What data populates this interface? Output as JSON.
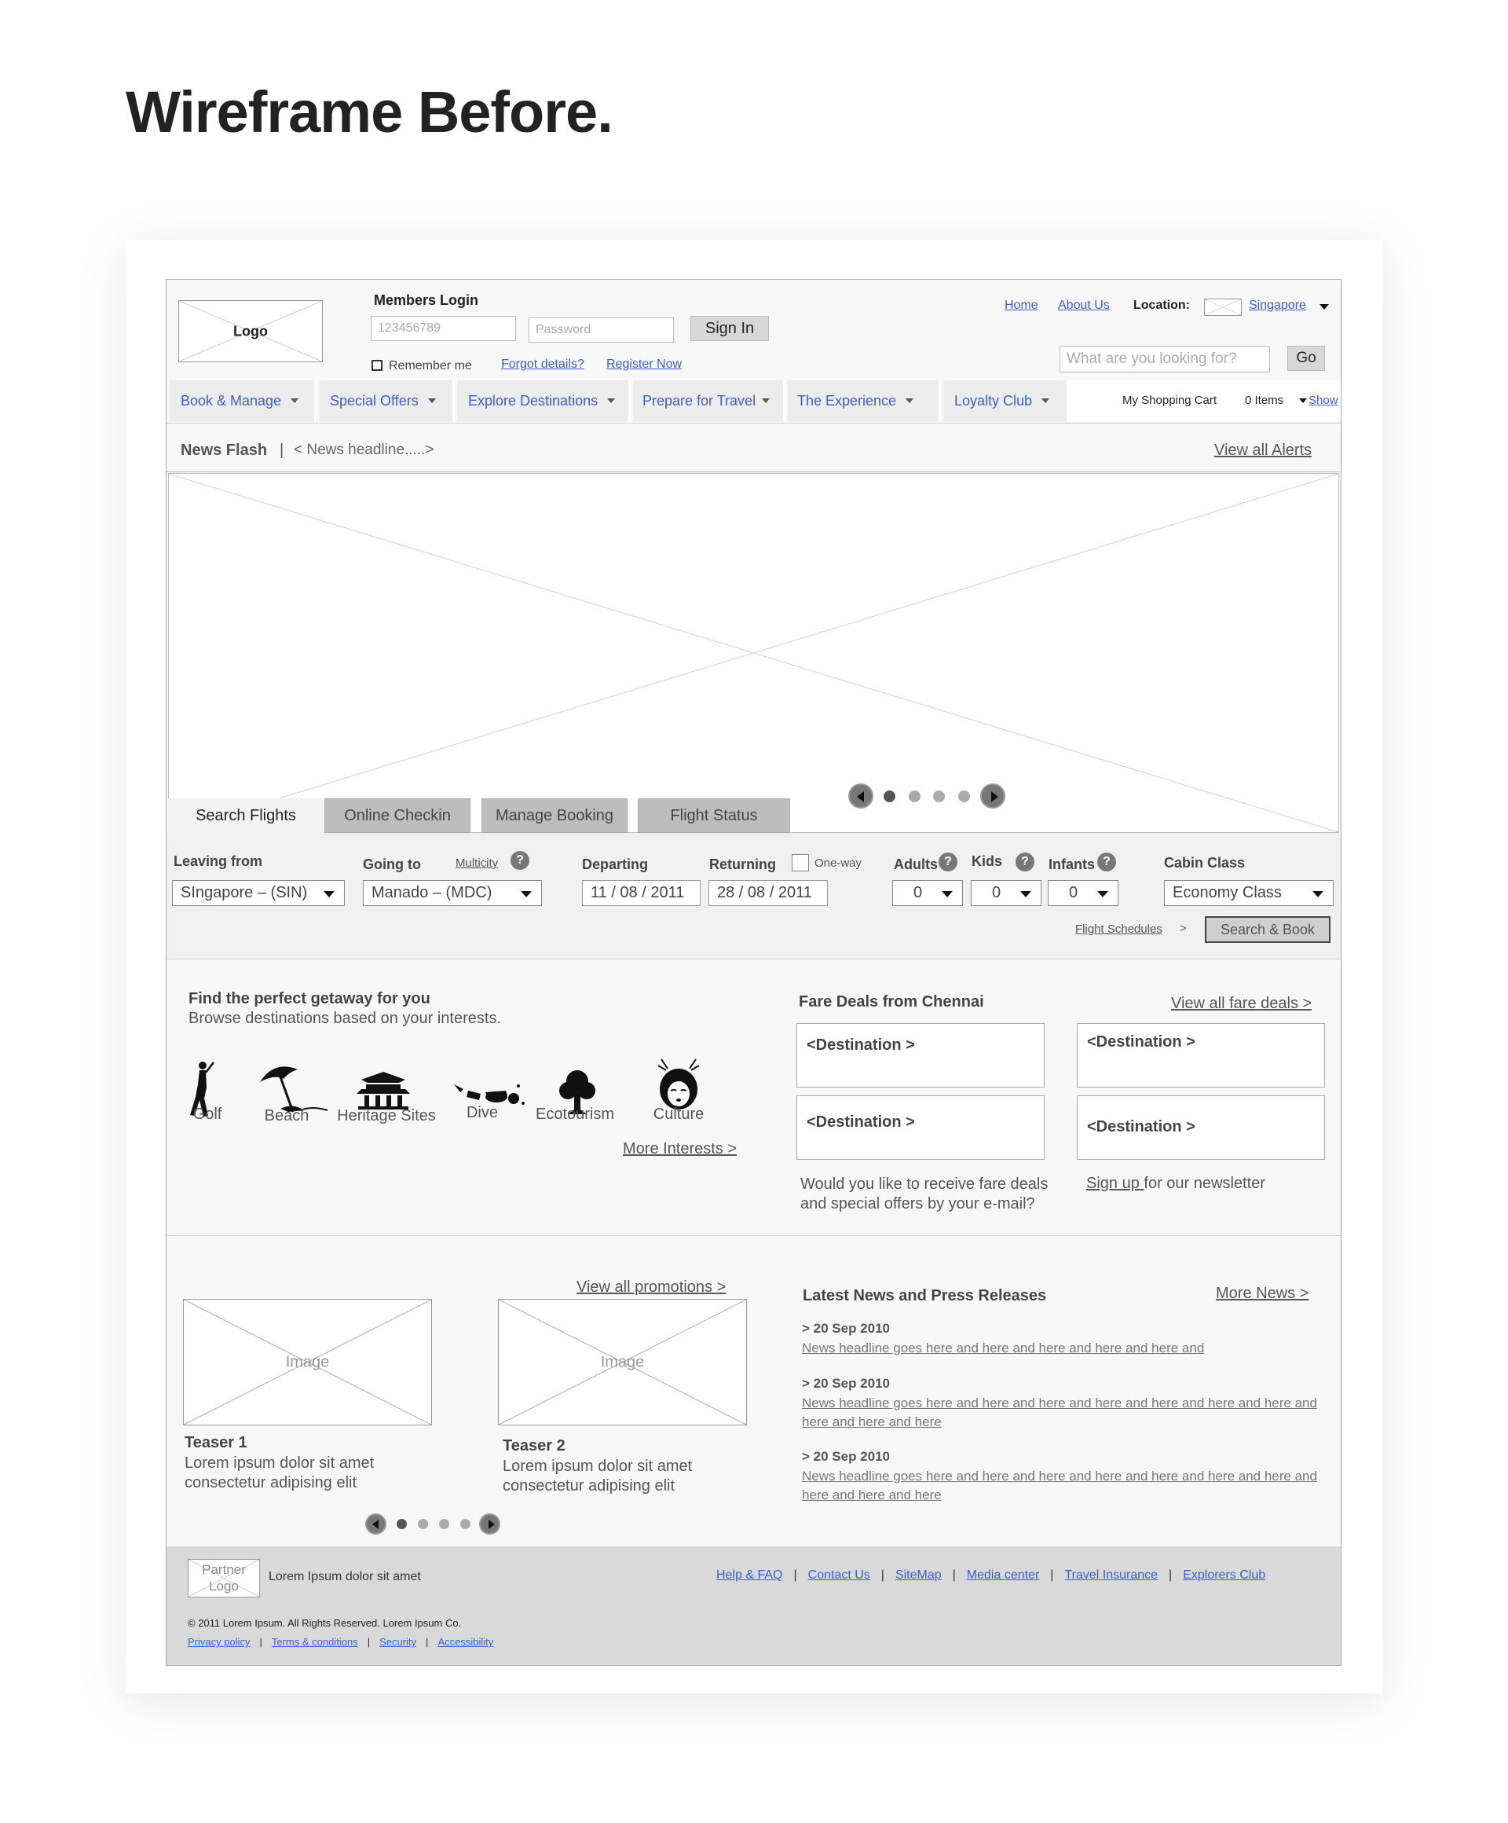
{
  "page_heading": "Wireframe Before.",
  "header": {
    "logo": "Logo",
    "members_login": "Members Login",
    "member_id_placeholder": "123456789",
    "password_placeholder": "Password",
    "sign_in": "Sign In",
    "remember_me": "Remember me",
    "forgot_details": "Forgot details?",
    "register_now": "Register Now",
    "home": "Home",
    "about_us": "About Us",
    "location_label": "Location:",
    "location_value": "Singapore",
    "search_placeholder": "What are you looking for?",
    "go": "Go",
    "cart_label": "My Shopping Cart",
    "cart_items": "0 Items",
    "cart_show": "Show"
  },
  "nav": {
    "items": [
      {
        "label": "Book & Manage"
      },
      {
        "label": "Special Offers"
      },
      {
        "label": "Explore Destinations"
      },
      {
        "label": "Prepare for Travel"
      },
      {
        "label": "The Experience"
      },
      {
        "label": "Loyalty Club"
      }
    ]
  },
  "news_flash": {
    "label": "News Flash",
    "separator": "|",
    "headline": "< News headline.....>",
    "view_all": "View all Alerts"
  },
  "booking": {
    "tabs": [
      {
        "label": "Search Flights",
        "active": true
      },
      {
        "label": "Online Checkin",
        "active": false
      },
      {
        "label": "Manage Booking",
        "active": false
      },
      {
        "label": "Flight Status",
        "active": false
      }
    ],
    "leaving_from": {
      "label": "Leaving from",
      "value": "SIngapore – (SIN)"
    },
    "going_to": {
      "label": "Going to",
      "value": "Manado – (MDC)"
    },
    "multicity": "Multicity",
    "departing": {
      "label": "Departing",
      "value": "11 / 08 / 2011"
    },
    "returning": {
      "label": "Returning",
      "value": "28 / 08 / 2011"
    },
    "one_way": "One-way",
    "adults": {
      "label": "Adults",
      "value": "0"
    },
    "kids": {
      "label": "Kids",
      "value": "0"
    },
    "infants": {
      "label": "Infants",
      "value": "0"
    },
    "cabin_class": {
      "label": "Cabin Class",
      "value": "Economy Class"
    },
    "help_glyph": "?",
    "flight_schedules": "Flight Schedules",
    "flight_schedules_arrow": ">",
    "search_book": "Search & Book"
  },
  "getaway": {
    "title": "Find the perfect getaway for you",
    "subtitle": "Browse destinations based on your interests.",
    "interests": [
      {
        "label": "Golf",
        "icon": "golf-icon"
      },
      {
        "label": "Beach",
        "icon": "beach-icon"
      },
      {
        "label": "Heritage Sites",
        "icon": "heritage-icon"
      },
      {
        "label": "Dive",
        "icon": "dive-icon"
      },
      {
        "label": "Ecotourism",
        "icon": "tree-icon"
      },
      {
        "label": "Culture",
        "icon": "culture-icon"
      }
    ],
    "more_interests": "More Interests >"
  },
  "fare_deals": {
    "title": "Fare Deals from Chennai",
    "view_all": "View all fare deals >",
    "destinations": [
      "<Destination >",
      "<Destination >",
      "<Destination >",
      "<Destination >"
    ],
    "newsletter_question": "Would you like to receive fare deals and special offers by your e-mail?",
    "sign_up": "Sign up ",
    "newsletter_suffix": "for our newsletter"
  },
  "promotions": {
    "view_all": "View all promotions >",
    "teasers": [
      {
        "image": "Image",
        "title": "Teaser 1",
        "text": "Lorem ipsum dolor sit amet consectetur adipising elit"
      },
      {
        "image": "Image",
        "title": "Teaser 2",
        "text": "Lorem ipsum dolor sit amet consectetur adipising elit"
      }
    ]
  },
  "news": {
    "title": "Latest News and Press Releases",
    "more": "More News >",
    "items": [
      {
        "date": "> 20 Sep 2010",
        "headline": "News headline goes here and here and here and here and here and"
      },
      {
        "date": "> 20 Sep 2010",
        "headline": "News headline goes here and here and here and here and here and here and here and here and here and here"
      },
      {
        "date": "> 20 Sep 2010",
        "headline": "News headline goes here and here and here and here and here and here and here and here and here and here"
      }
    ]
  },
  "footer": {
    "partner_logo": "Partner Logo",
    "tagline": "Lorem Ipsum  dolor sit amet",
    "links": [
      "Help & FAQ",
      "Contact Us",
      "SiteMap",
      "Media center",
      "Travel Insurance ",
      "Explorers Club"
    ],
    "copyright": "© 2011 Lorem Ipsum. All Rights Reserved. Lorem Ipsum Co.",
    "legal_links": [
      "Privacy policy",
      "Terms & conditions",
      "Security",
      "Accessibility"
    ]
  },
  "colors": {
    "link": "#3a5fcd",
    "wire_bg": "#f7f7f7",
    "footer_bg": "#d9d9d9"
  }
}
